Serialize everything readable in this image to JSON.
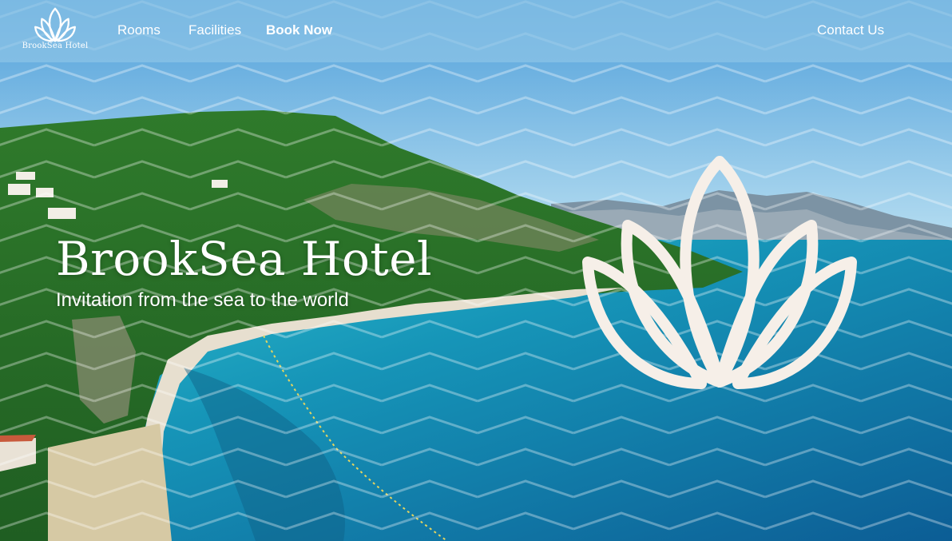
{
  "brand": {
    "name": "BrookSea Hotel",
    "logo_icon": "lotus-icon"
  },
  "nav": {
    "rooms_label": "Rooms",
    "facilities_label": "Facilities",
    "book_label": "Book Now",
    "contact_label": "Contact Us"
  },
  "hero": {
    "title": "BrookSea Hotel",
    "subtitle": "Invitation from the sea to the world",
    "emblem_icon": "lotus-icon",
    "pattern": "chevron-zigzag"
  },
  "colors": {
    "nav_overlay": "#8cc4e6",
    "sky": "#7ec3ea",
    "sea": "#1f9fc0",
    "hills": "#3d8a35",
    "lotus": "#f6efe8",
    "text": "#ffffff"
  }
}
